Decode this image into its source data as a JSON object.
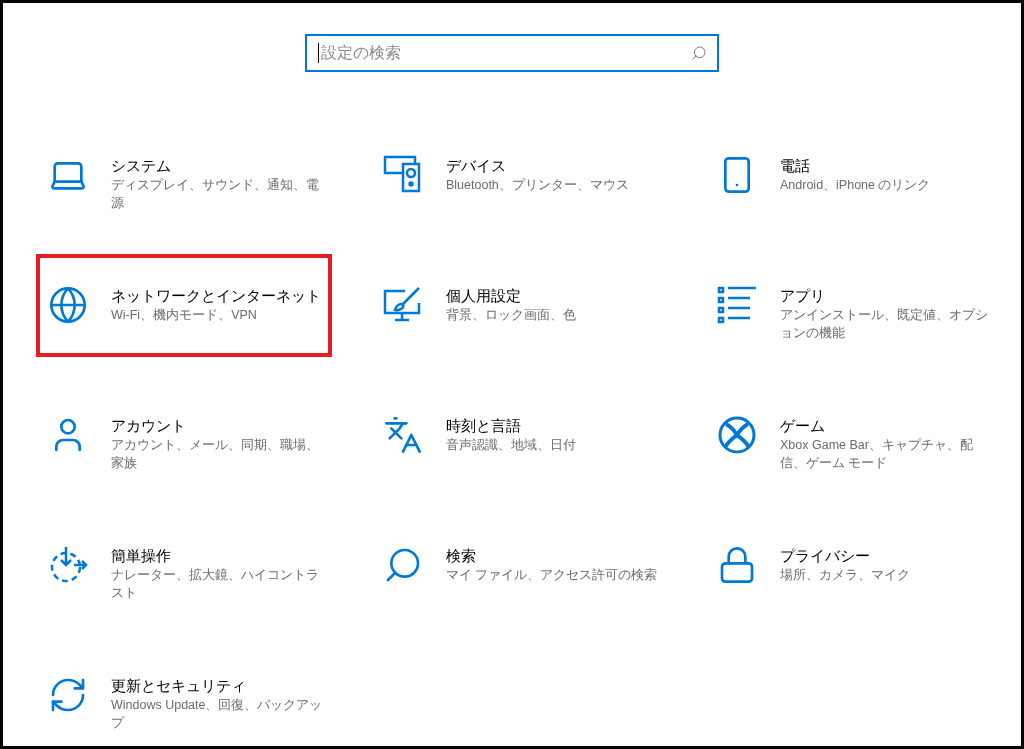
{
  "search": {
    "placeholder": "設定の検索",
    "focused": true
  },
  "categories": [
    {
      "kind": "system",
      "title": "システム",
      "description": "ディスプレイ、サウンド、通知、電源",
      "highlighted": false
    },
    {
      "kind": "devices",
      "title": "デバイス",
      "description": "Bluetooth、プリンター、マウス",
      "highlighted": false
    },
    {
      "kind": "phone",
      "title": "電話",
      "description": "Android、iPhone のリンク",
      "highlighted": false
    },
    {
      "kind": "network",
      "title": "ネットワークとインターネット",
      "description": "Wi-Fi、機内モード、VPN",
      "highlighted": true
    },
    {
      "kind": "personalization",
      "title": "個人用設定",
      "description": "背景、ロック画面、色",
      "highlighted": false
    },
    {
      "kind": "apps",
      "title": "アプリ",
      "description": "アンインストール、既定値、オプションの機能",
      "highlighted": false
    },
    {
      "kind": "accounts",
      "title": "アカウント",
      "description": "アカウント、メール、同期、職場、家族",
      "highlighted": false
    },
    {
      "kind": "time",
      "title": "時刻と言語",
      "description": "音声認識、地域、日付",
      "highlighted": false
    },
    {
      "kind": "gaming",
      "title": "ゲーム",
      "description": "Xbox Game Bar、キャプチャ、配信、ゲーム モード",
      "highlighted": false
    },
    {
      "kind": "ease",
      "title": "簡単操作",
      "description": "ナレーター、拡大鏡、ハイコントラスト",
      "highlighted": false
    },
    {
      "kind": "search",
      "title": "検索",
      "description": "マイ ファイル、アクセス許可の検索",
      "highlighted": false
    },
    {
      "kind": "privacy",
      "title": "プライバシー",
      "description": "場所、カメラ、マイク",
      "highlighted": false
    },
    {
      "kind": "update",
      "title": "更新とセキュリティ",
      "description": "Windows Update、回復、バックアップ",
      "highlighted": false
    }
  ]
}
